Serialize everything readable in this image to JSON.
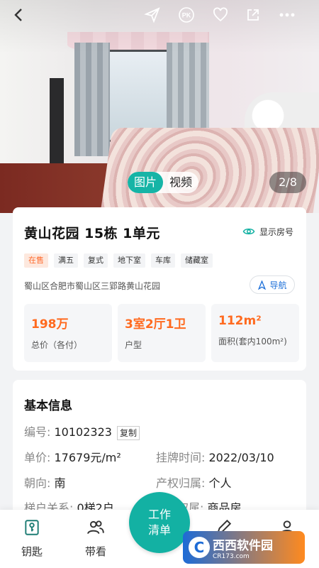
{
  "gallery": {
    "tabs": [
      {
        "label": "图片",
        "active": true
      },
      {
        "label": "视频",
        "active": false
      }
    ],
    "page_counter": "2/8"
  },
  "toolbar": {
    "icons": [
      "back-icon",
      "send-icon",
      "pk-icon",
      "heart-icon",
      "share-icon",
      "more-icon"
    ],
    "pk_label": "PK"
  },
  "listing": {
    "title": "黄山花园  15栋 1单元",
    "show_number_label": "显示房号",
    "tags": [
      {
        "label": "在售",
        "highlight": true
      },
      {
        "label": "满五"
      },
      {
        "label": "复式"
      },
      {
        "label": "地下室"
      },
      {
        "label": "车库"
      },
      {
        "label": "储藏室"
      }
    ],
    "address": "蜀山区合肥市蜀山区三郢路黄山花园",
    "nav_label": "导航",
    "stats": [
      {
        "value": "198万",
        "label": "总价（各付）"
      },
      {
        "value": "3室2厅1卫",
        "label": "户型"
      },
      {
        "value": "112m²",
        "label": "面积(套内100m²)"
      }
    ]
  },
  "basic_info": {
    "heading": "基本信息",
    "id_label": "编号:",
    "id_value": "10102323",
    "copy_label": "复制",
    "unit_price_label": "单价:",
    "unit_price_value": "17679元/m²",
    "listed_label": "挂牌时间:",
    "listed_value": "2022/03/10",
    "orientation_label": "朝向:",
    "orientation_value": "南",
    "ownership_label": "产权归属:",
    "ownership_value": "个人",
    "elevator_label": "梯户关系:",
    "elevator_value": "0梯2户",
    "rights_label": "权属:",
    "rights_value": "商品房"
  },
  "bottom_nav": {
    "items": [
      {
        "label": "钥匙",
        "icon": "key-icon"
      },
      {
        "label": "带看",
        "icon": "people-icon"
      },
      {
        "label": "",
        "icon": "edit-icon"
      },
      {
        "label": "",
        "icon": "user-icon"
      }
    ],
    "center_line1": "工作",
    "center_line2": "清单"
  },
  "watermark": {
    "text": "西西软件园",
    "sub": "CR173.com"
  },
  "colors": {
    "accent": "#13b1a3",
    "price": "#ff6a1f",
    "link": "#1c6fd8"
  }
}
